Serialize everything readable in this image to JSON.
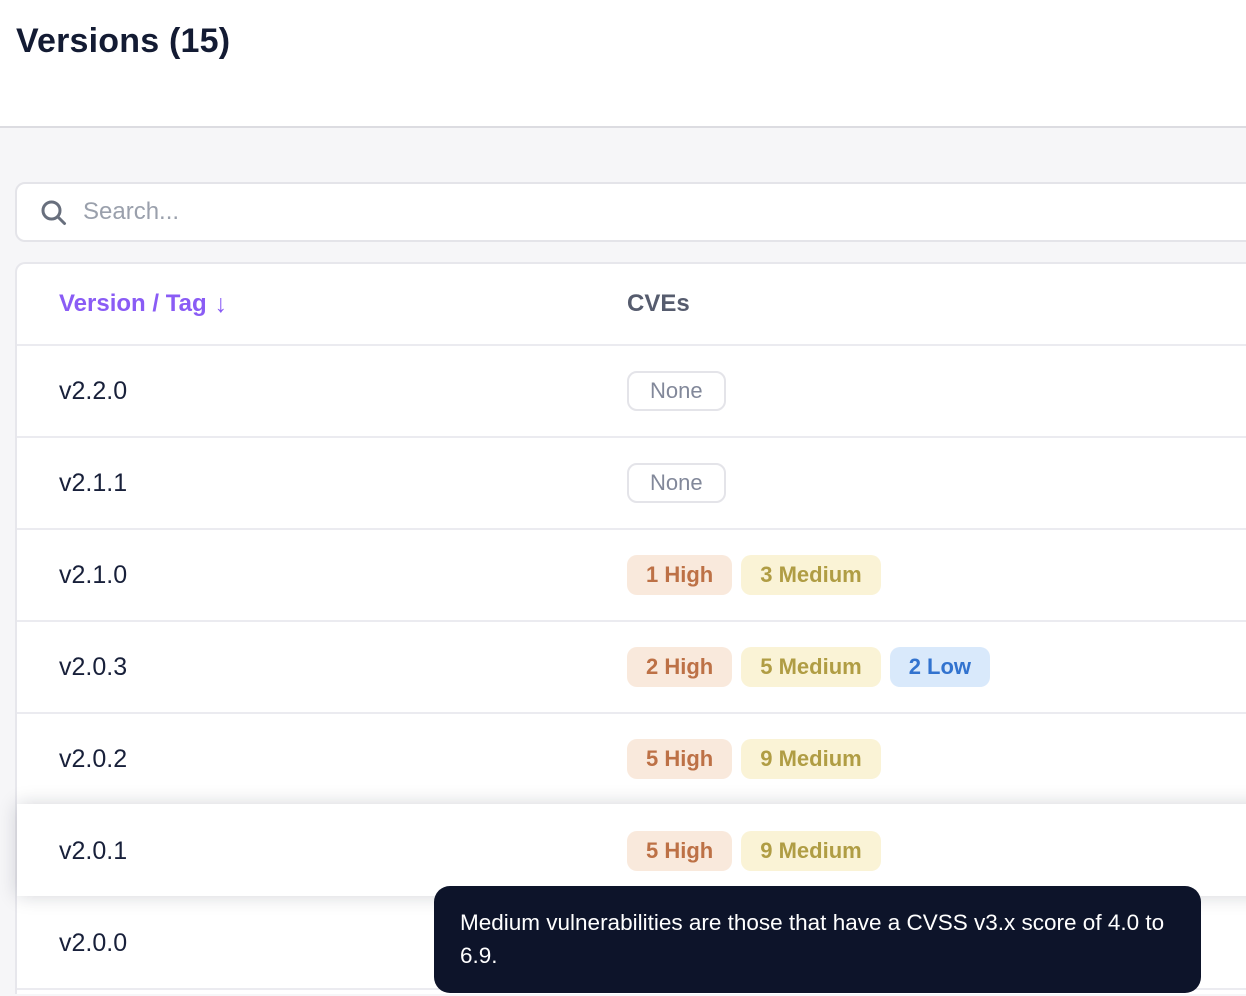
{
  "header": {
    "title": "Versions (15)"
  },
  "search": {
    "placeholder": "Search...",
    "value": ""
  },
  "table": {
    "columns": {
      "version": "Version / Tag",
      "cves": "CVEs"
    },
    "sort_icon": "↓",
    "rows": [
      {
        "version": "v2.2.0",
        "badges": [
          {
            "type": "none",
            "label": "None"
          }
        ],
        "hovered": false
      },
      {
        "version": "v2.1.1",
        "badges": [
          {
            "type": "none",
            "label": "None"
          }
        ],
        "hovered": false
      },
      {
        "version": "v2.1.0",
        "badges": [
          {
            "type": "high",
            "label": "1 High"
          },
          {
            "type": "medium",
            "label": "3 Medium"
          }
        ],
        "hovered": false
      },
      {
        "version": "v2.0.3",
        "badges": [
          {
            "type": "high",
            "label": "2 High"
          },
          {
            "type": "medium",
            "label": "5 Medium"
          },
          {
            "type": "low",
            "label": "2 Low"
          }
        ],
        "hovered": false
      },
      {
        "version": "v2.0.2",
        "badges": [
          {
            "type": "high",
            "label": "5 High"
          },
          {
            "type": "medium",
            "label": "9 Medium"
          }
        ],
        "hovered": false
      },
      {
        "version": "v2.0.1",
        "badges": [
          {
            "type": "high",
            "label": "5 High"
          },
          {
            "type": "medium",
            "label": "9 Medium"
          }
        ],
        "hovered": true
      },
      {
        "version": "v2.0.0",
        "badges": [],
        "hovered": false
      }
    ]
  },
  "tooltip": {
    "text": "Medium vulnerabilities are those that have a CVSS v3.x score of 4.0 to 6.9."
  },
  "colors": {
    "title-text": "#131b33",
    "accent-purple": "#8a5cf5",
    "high-bg": "#f9e9dc",
    "high-text": "#bd7146",
    "medium-bg": "#faf3d6",
    "medium-text": "#b09d44",
    "low-bg": "#d9e9fb",
    "low-text": "#3273cf",
    "tooltip-bg": "#0d142a"
  }
}
